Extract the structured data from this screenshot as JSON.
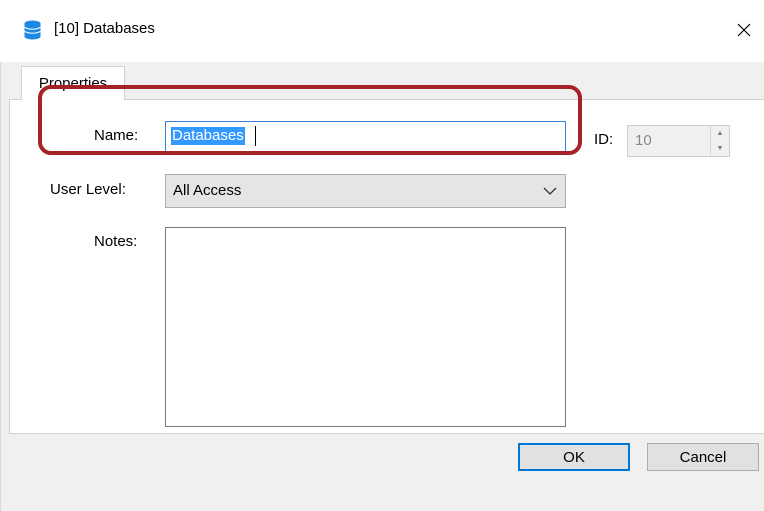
{
  "window": {
    "title": "[10] Databases",
    "icon": "database-icon",
    "close_icon": "close-icon"
  },
  "tabs": [
    {
      "label": "Properties",
      "selected": true
    }
  ],
  "form": {
    "name_label": "Name:",
    "name_value": "Databases",
    "id_label": "ID:",
    "id_value": "10",
    "user_level_label": "User Level:",
    "user_level_value": "All Access",
    "notes_label": "Notes:",
    "notes_value": ""
  },
  "buttons": {
    "ok_label": "OK",
    "cancel_label": "Cancel"
  },
  "colors": {
    "highlight": "#a52226",
    "selection": "#3399ff",
    "focus_border": "#0078d7",
    "icon_blue": "#1e88e5"
  }
}
